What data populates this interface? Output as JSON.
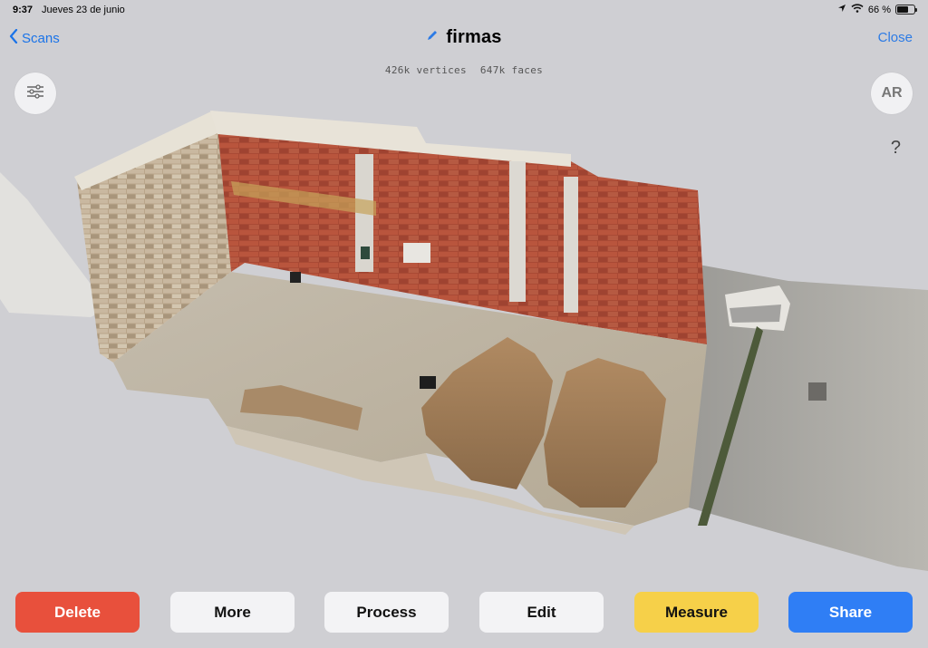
{
  "status": {
    "time": "9:37",
    "date": "Jueves 23 de junio",
    "battery": "66 %",
    "battery_level": 0.66
  },
  "nav": {
    "back_label": "Scans",
    "title": "firmas",
    "close_label": "Close"
  },
  "mesh": {
    "vertices": "426k vertices",
    "faces": "647k faces"
  },
  "controls": {
    "ar_label": "AR",
    "help_glyph": "?"
  },
  "toolbar": {
    "delete": "Delete",
    "more": "More",
    "process": "Process",
    "edit": "Edit",
    "measure": "Measure",
    "share": "Share"
  },
  "icons": [
    "chevron-left-icon",
    "pencil-icon",
    "sliders-icon",
    "question-icon",
    "location-icon",
    "wifi-icon",
    "battery-icon"
  ],
  "colors": {
    "accent": "#2f7ef5",
    "delete": "#e8503c",
    "measure": "#f6d049",
    "background": "#cfcfd3"
  }
}
